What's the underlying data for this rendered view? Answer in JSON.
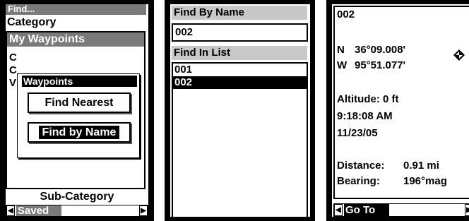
{
  "screen1": {
    "title": "Find...",
    "category_label": "Category",
    "category_selected": "My Waypoints",
    "list_chars": [
      "C",
      "C",
      "V"
    ],
    "popup": {
      "title": "Waypoints",
      "find_nearest": "Find Nearest",
      "find_by_name": "Find by Name"
    },
    "subcategory_label": "Sub-Category",
    "subcategory_value": "Saved"
  },
  "screen2": {
    "find_by_name_label": "Find By Name",
    "name_value": "002",
    "find_in_list_label": "Find In List",
    "list_items": [
      "001",
      "002"
    ],
    "selected_item": "002"
  },
  "screen3": {
    "name": "002",
    "lat_prefix": "N",
    "lat": "36°09.008'",
    "lon_prefix": "W",
    "lon": "95°51.077'",
    "altitude": "Altitude: 0 ft",
    "time": "9:18:08 AM",
    "date": "11/23/05",
    "distance_label": "Distance:",
    "distance_value": "0.91 mi",
    "bearing_label": "Bearing:",
    "bearing_value": "196°mag",
    "action": "Go To",
    "waypoint_icon": "diamond-waypoint-icon"
  }
}
